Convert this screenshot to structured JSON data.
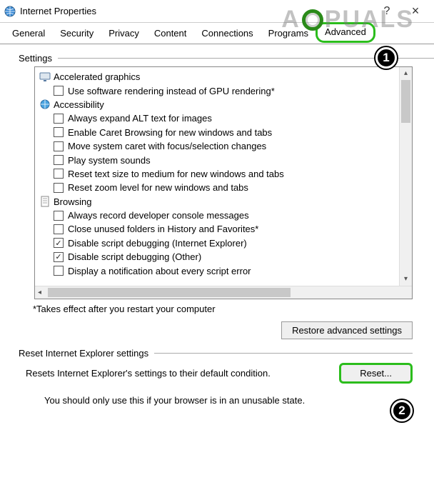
{
  "window": {
    "title": "Internet Properties",
    "help": "?",
    "close": "×"
  },
  "tabs": [
    "General",
    "Security",
    "Privacy",
    "Content",
    "Connections",
    "Programs",
    "Advanced"
  ],
  "settings_label": "Settings",
  "tree": {
    "categories": [
      {
        "icon": "monitor-icon",
        "label": "Accelerated graphics",
        "items": [
          {
            "checked": false,
            "label": "Use software rendering instead of GPU rendering*"
          }
        ]
      },
      {
        "icon": "globe-icon",
        "label": "Accessibility",
        "items": [
          {
            "checked": false,
            "label": "Always expand ALT text for images"
          },
          {
            "checked": false,
            "label": "Enable Caret Browsing for new windows and tabs"
          },
          {
            "checked": false,
            "label": "Move system caret with focus/selection changes"
          },
          {
            "checked": false,
            "label": "Play system sounds"
          },
          {
            "checked": false,
            "label": "Reset text size to medium for new windows and tabs"
          },
          {
            "checked": false,
            "label": "Reset zoom level for new windows and tabs"
          }
        ]
      },
      {
        "icon": "page-icon",
        "label": "Browsing",
        "items": [
          {
            "checked": false,
            "label": "Always record developer console messages"
          },
          {
            "checked": false,
            "label": "Close unused folders in History and Favorites*"
          },
          {
            "checked": true,
            "label": "Disable script debugging (Internet Explorer)"
          },
          {
            "checked": true,
            "label": "Disable script debugging (Other)"
          },
          {
            "checked": false,
            "label": "Display a notification about every script error"
          }
        ]
      }
    ]
  },
  "restart_note": "*Takes effect after you restart your computer",
  "restore_button": "Restore advanced settings",
  "reset": {
    "group_label": "Reset Internet Explorer settings",
    "description": "Resets Internet Explorer's settings to their default condition.",
    "button": "Reset...",
    "warning": "You should only use this if your browser is in an unusable state."
  },
  "annotations": {
    "badge1": "1",
    "badge2": "2"
  },
  "watermark": {
    "left": "A",
    "right": "PUALS"
  }
}
